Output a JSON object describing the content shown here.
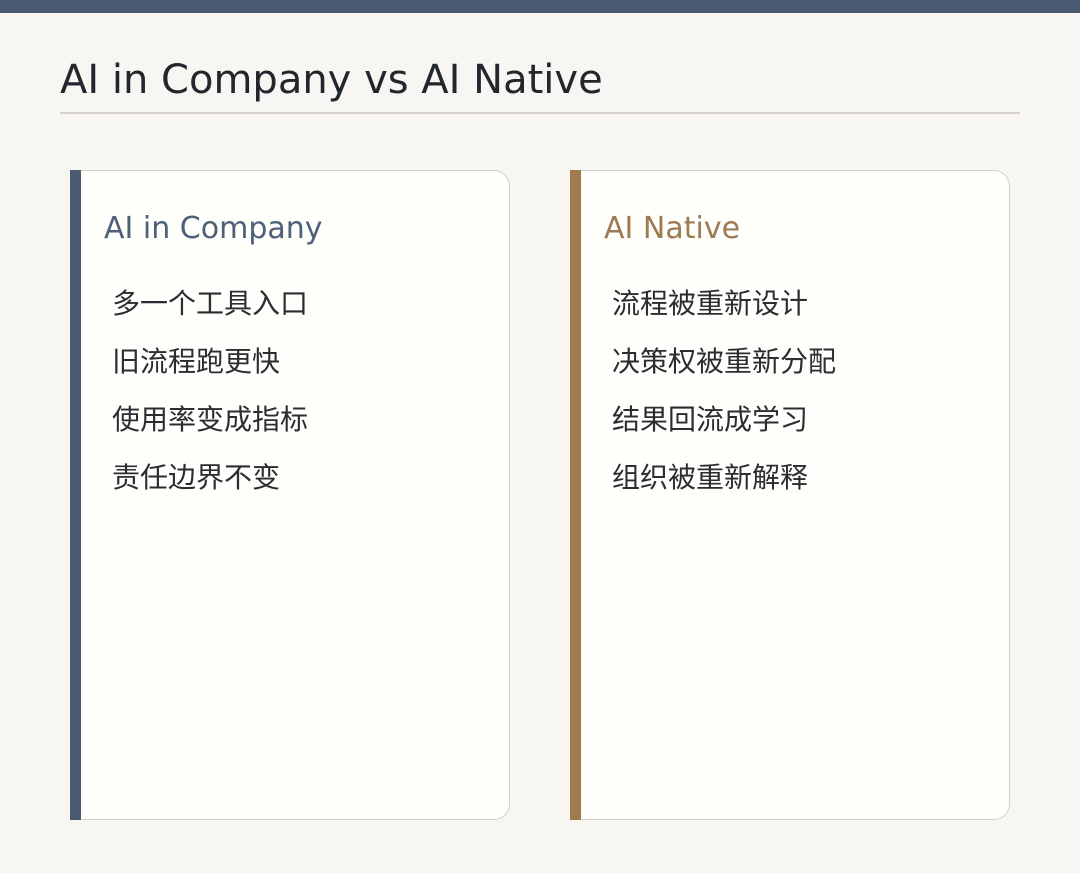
{
  "page": {
    "title": "AI in Company vs AI Native"
  },
  "left_card": {
    "title": "AI in Company",
    "items": [
      "多一个工具入口",
      "旧流程跑更快",
      "使用率变成指标",
      "责任边界不变"
    ]
  },
  "right_card": {
    "title": "AI Native",
    "items": [
      "流程被重新设计",
      "决策权被重新分配",
      "结果回流成学习",
      "组织被重新解释"
    ]
  },
  "colors": {
    "top_bar": "#4a5a72",
    "left_accent": "#4a5a72",
    "right_accent": "#a07b52",
    "background": "#f7f6f3",
    "card_background": "#fefefa"
  }
}
